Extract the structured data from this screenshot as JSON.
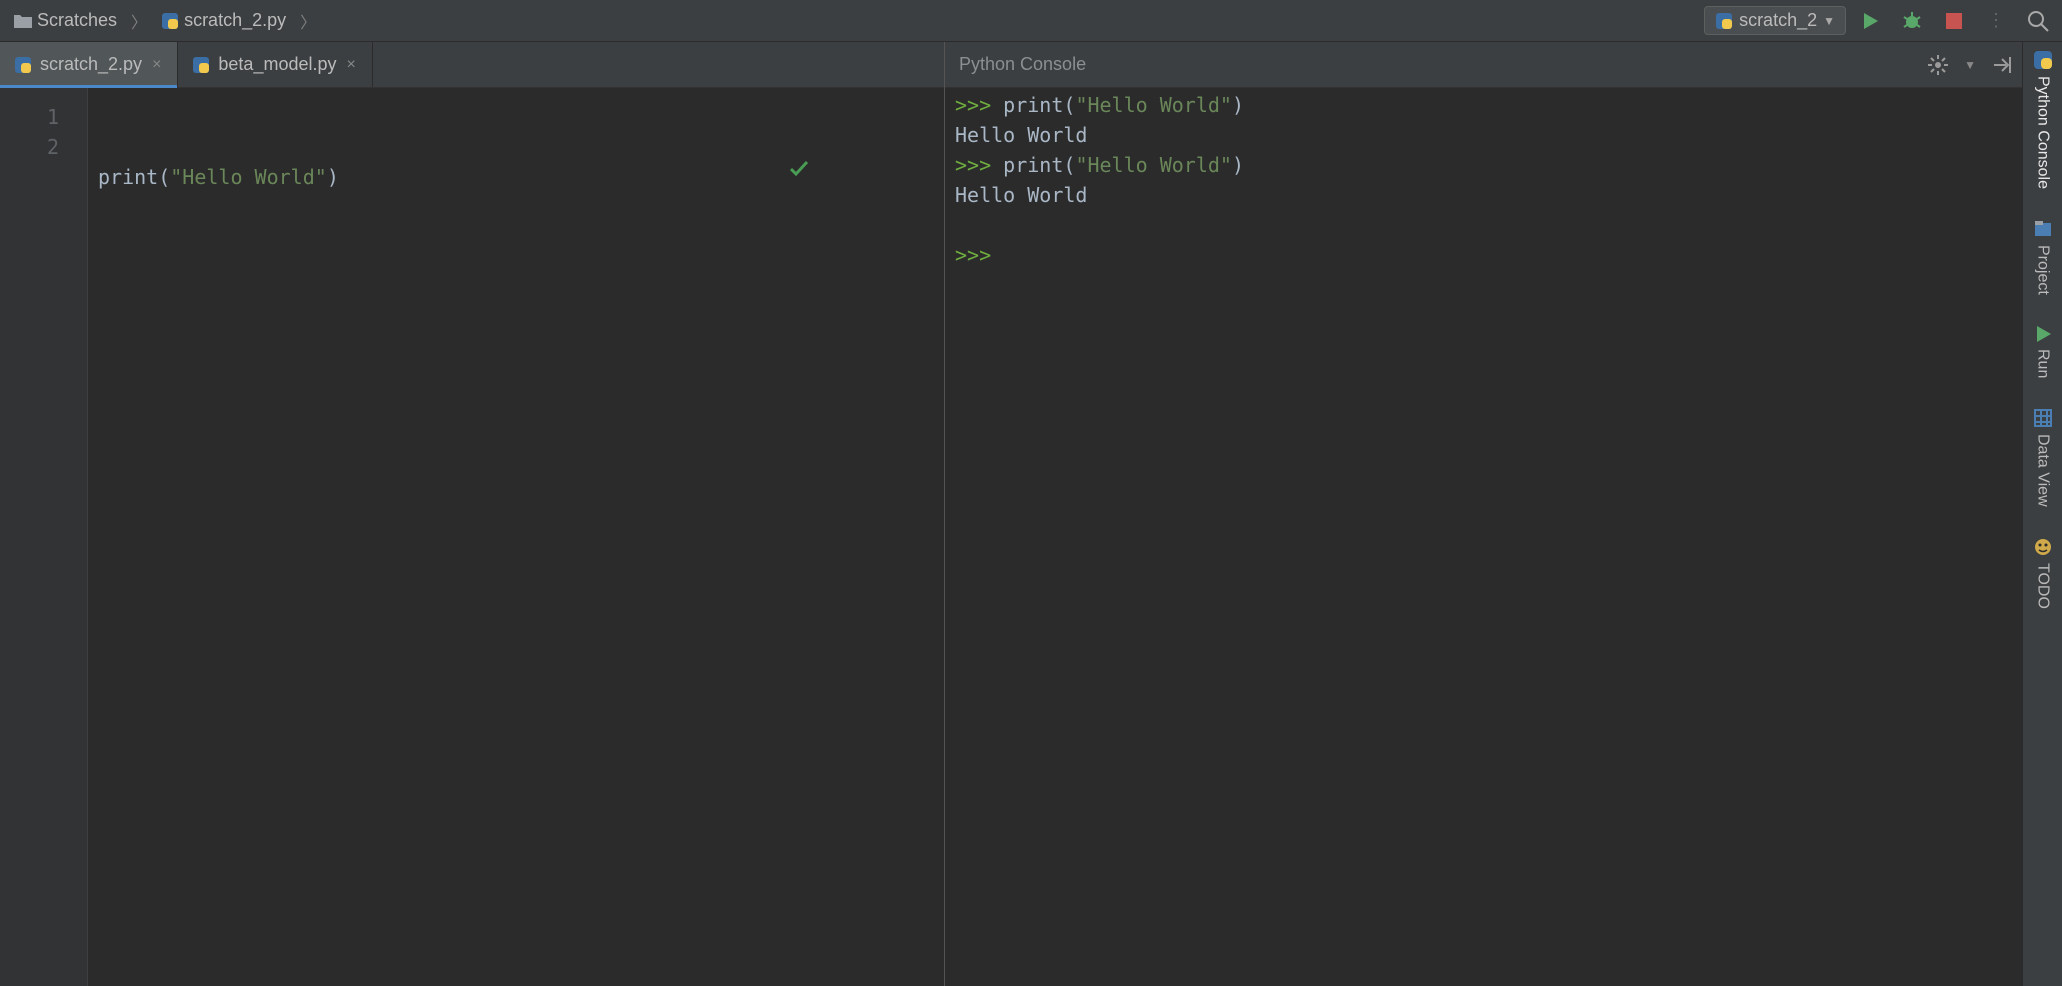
{
  "breadcrumbs": {
    "folder": "Scratches",
    "file": "scratch_2.py"
  },
  "run_config": {
    "label": "scratch_2"
  },
  "tabs": [
    {
      "label": "scratch_2.py",
      "active": true
    },
    {
      "label": "beta_model.py",
      "active": false
    }
  ],
  "editor": {
    "gutter": [
      "1",
      "2"
    ],
    "code": {
      "fn": "print",
      "open": "(",
      "string": "\"Hello World\"",
      "close": ")"
    }
  },
  "console": {
    "title": "Python Console",
    "lines": [
      {
        "prompt": ">>> ",
        "fn": "print",
        "open": "(",
        "string": "\"Hello World\"",
        "close": ")"
      },
      {
        "out": "Hello World"
      },
      {
        "prompt": ">>> ",
        "fn": "print",
        "open": "(",
        "string": "\"Hello World\"",
        "close": ")"
      },
      {
        "out": "Hello World"
      },
      {
        "blank": true
      },
      {
        "prompt": ">>> "
      }
    ]
  },
  "right_stripe": {
    "items": [
      {
        "label": "Python Console",
        "icon": "python-icon",
        "active": true
      },
      {
        "label": "Project",
        "icon": "project-icon",
        "active": false
      },
      {
        "label": "Run",
        "icon": "run-icon",
        "active": false
      },
      {
        "label": "Data View",
        "icon": "dataview-icon",
        "active": false
      },
      {
        "label": "TODO",
        "icon": "todo-icon",
        "active": false
      }
    ]
  }
}
